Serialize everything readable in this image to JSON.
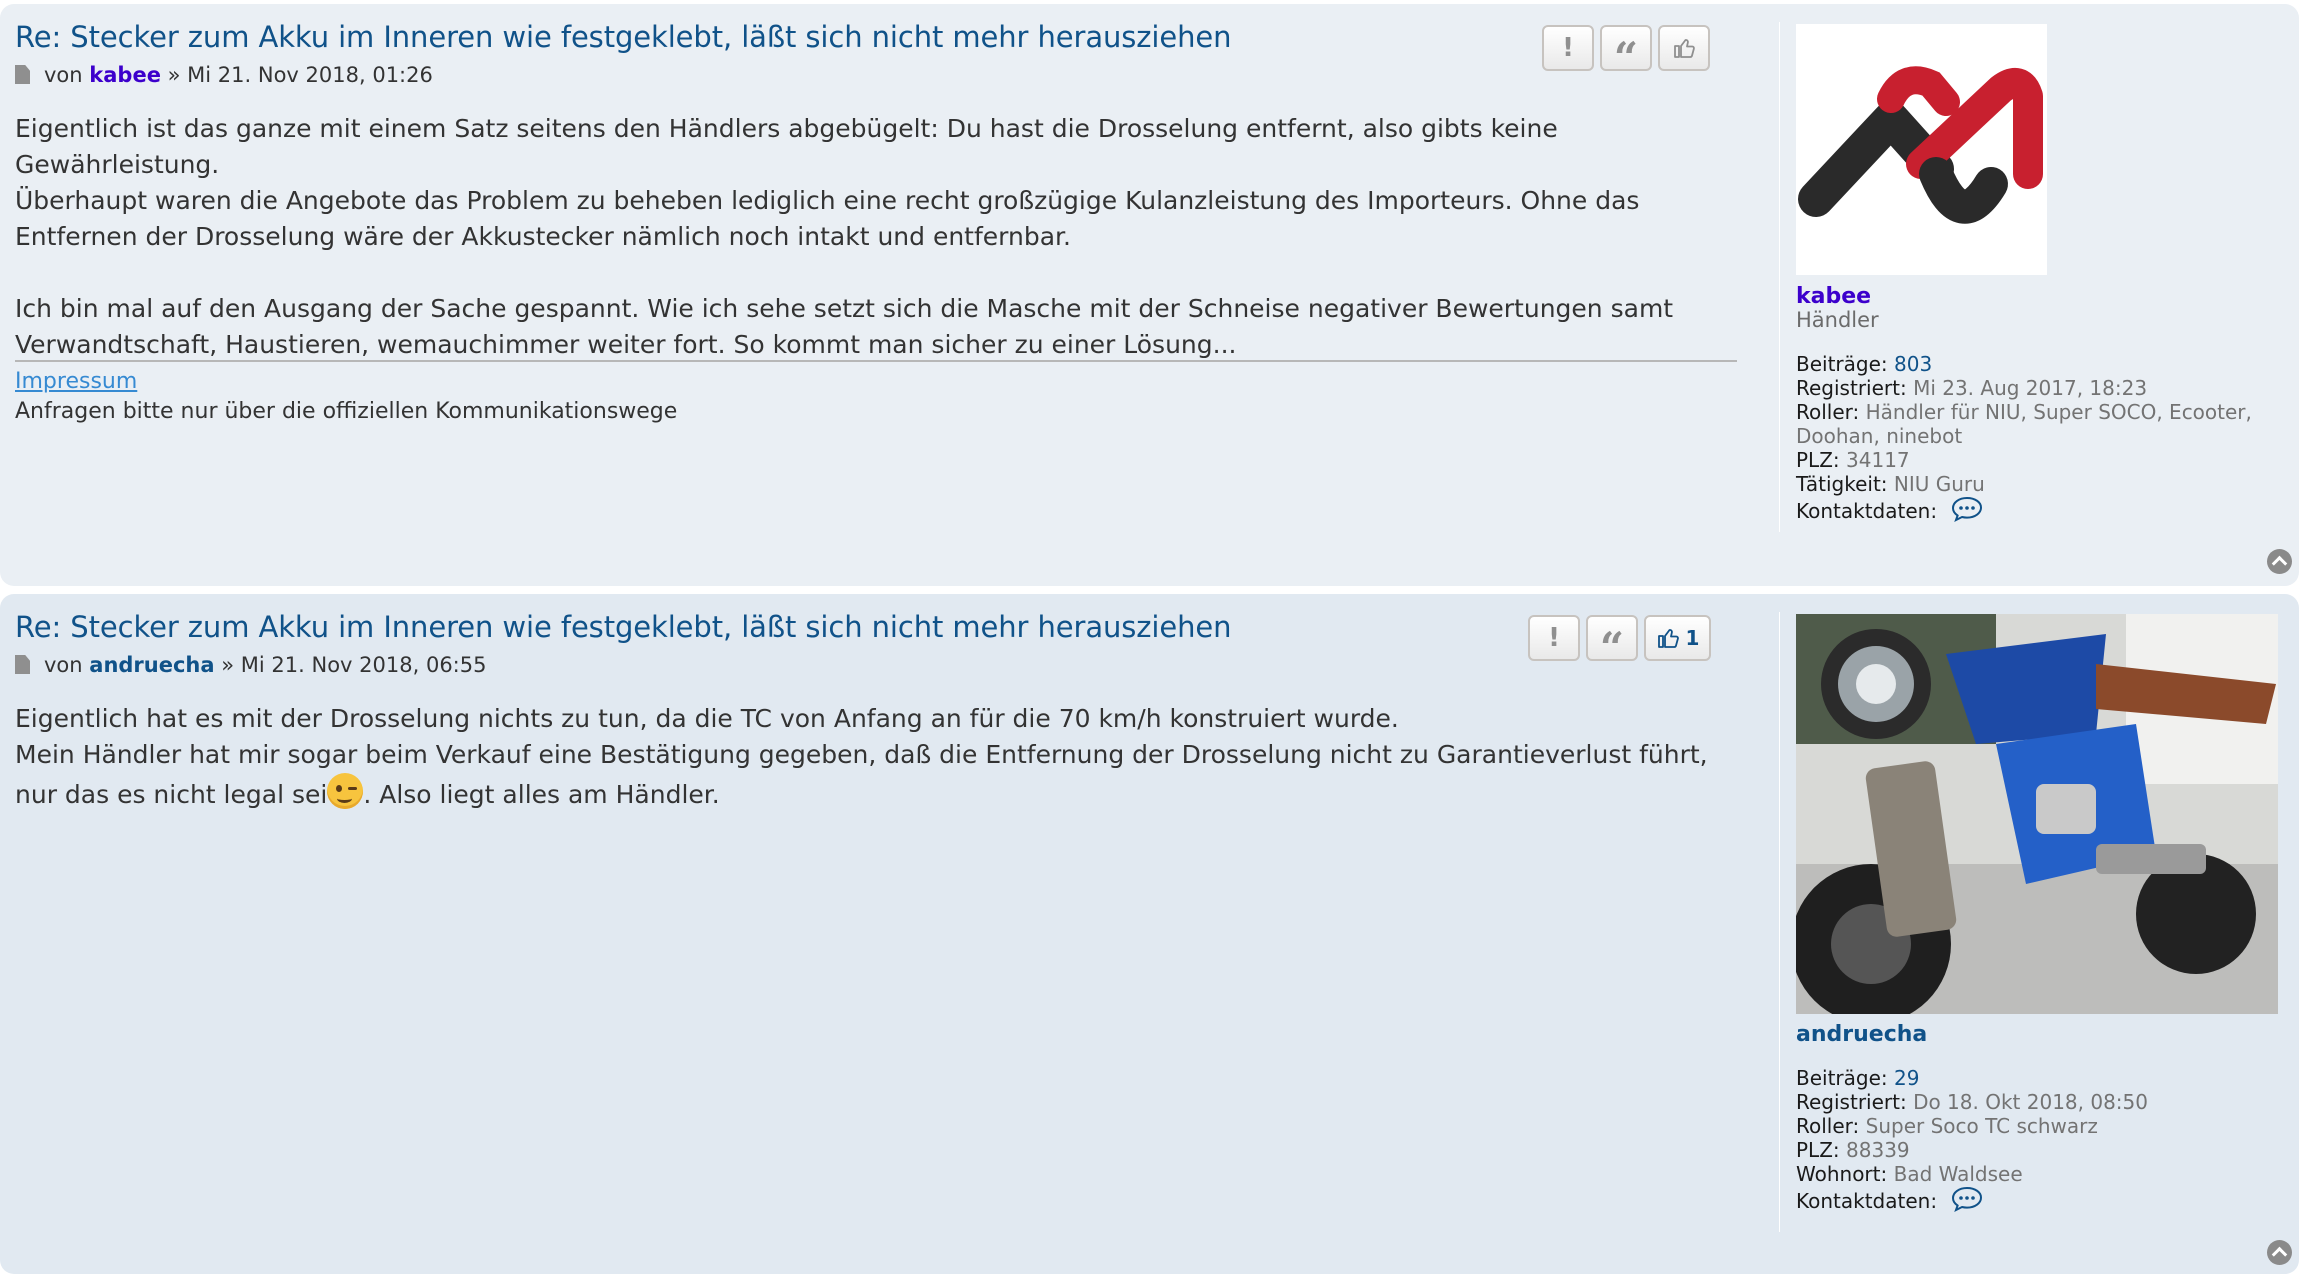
{
  "posts": [
    {
      "title": "Re: Stecker zum Akku im Inneren wie festgeklebt, läßt sich nicht mehr herausziehen",
      "meta_prefix": "von",
      "author": "kabee",
      "meta_sep": "»",
      "date": "Mi 21. Nov 2018, 01:26",
      "content": [
        "Eigentlich ist das ganze mit einem Satz seitens den Händlers abgebügelt: Du hast die Drosselung entfernt, also gibts keine Gewährleistung.",
        "Überhaupt waren die Angebote das Problem zu beheben lediglich eine recht großzügige Kulanzleistung des Importeurs. Ohne das Entfernen der Drosselung wäre der Akkustecker nämlich noch intakt und entfernbar.",
        "Ich bin mal auf den Ausgang der Sache gespannt. Wie ich sehe setzt sich die Masche mit der Schneise negativer Bewertungen samt Verwandtschaft, Haustieren, wemauchimmer weiter fort. So kommt man sicher zu einer Lösung..."
      ],
      "signature_link": "Impressum",
      "signature_text": "Anfragen bitte nur über die offiziellen Kommunikationswege",
      "buttons": {
        "like_count": ""
      },
      "profile": {
        "username": "kabee",
        "rank": "Händler",
        "fields": [
          {
            "label": "Beiträge:",
            "value": "803"
          },
          {
            "label": "Registriert:",
            "value": "Mi 23. Aug 2017, 18:23"
          },
          {
            "label": "Roller:",
            "value": "Händler für NIU, Super SOCO, Ecooter, Doohan, ninebot"
          },
          {
            "label": "PLZ:",
            "value": "34117"
          },
          {
            "label": "Tätigkeit:",
            "value": "NIU Guru"
          },
          {
            "label": "Kontaktdaten:",
            "value": ""
          }
        ]
      }
    },
    {
      "title": "Re: Stecker zum Akku im Inneren wie festgeklebt, läßt sich nicht mehr herausziehen",
      "meta_prefix": "von",
      "author": "andruecha",
      "meta_sep": "»",
      "date": "Mi 21. Nov 2018, 06:55",
      "content": [
        "Eigentlich hat es mit der Drosselung nichts zu tun, da die TC von Anfang an für die 70 km/h konstruiert wurde.",
        "Mein Händler hat mir sogar beim Verkauf eine Bestätigung gegeben, daß die Entfernung der Drosselung nicht zu Garantieverlust führt, nur das es nicht legal sei",
        ". Also liegt alles am Händler."
      ],
      "buttons": {
        "like_count": "1"
      },
      "profile": {
        "username": "andruecha",
        "fields": [
          {
            "label": "Beiträge:",
            "value": "29"
          },
          {
            "label": "Registriert:",
            "value": "Do 18. Okt 2018, 08:50"
          },
          {
            "label": "Roller:",
            "value": "Super Soco TC schwarz"
          },
          {
            "label": "PLZ:",
            "value": "88339"
          },
          {
            "label": "Wohnort:",
            "value": "Bad Waldsee"
          },
          {
            "label": "Kontaktdaten:",
            "value": ""
          }
        ]
      }
    }
  ],
  "colors": {
    "title": "#105289",
    "dealer_name": "#3c00cc",
    "member_name": "#105289",
    "post1_bg": "#eaeff4",
    "post2_bg": "#e1e9f1",
    "logo_red": "#c8202f",
    "logo_dark": "#2a2a2a"
  },
  "icons": {
    "report": "exclamation-icon",
    "quote": "quote-icon",
    "like": "thumbs-up-icon",
    "contact": "chat-bubble-icon",
    "back_to_top": "chevron-up-circle-icon",
    "post": "document-icon"
  }
}
